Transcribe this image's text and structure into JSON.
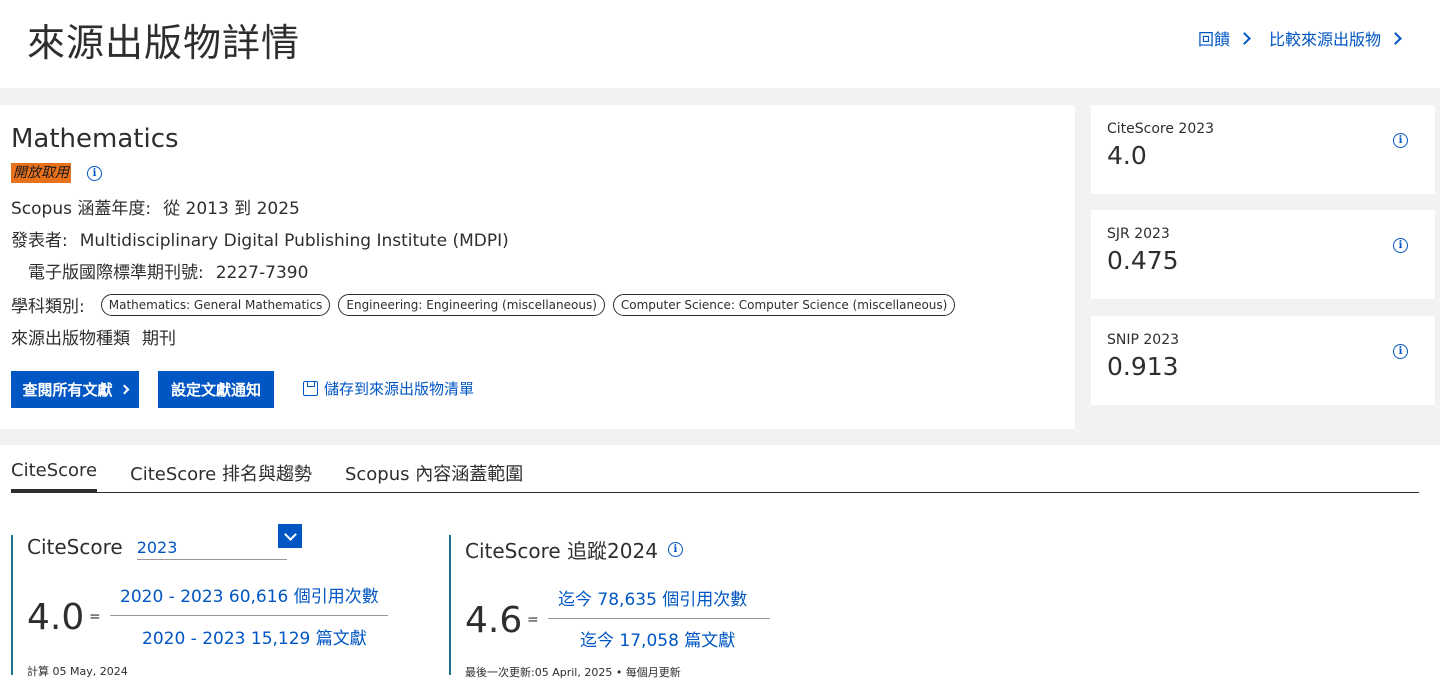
{
  "header": {
    "title": "來源出版物詳情",
    "feedback_label": "回饋",
    "compare_label": "比較來源出版物"
  },
  "journal": {
    "title": "Mathematics",
    "open_access": "開放取用",
    "coverage_label": "Scopus 涵蓋年度:",
    "coverage_value": "從 2013 到 2025",
    "publisher_label": "發表者:",
    "publisher_value": "Multidisciplinary Digital Publishing Institute (MDPI)",
    "eissn_label": "電子版國際標準期刊號:",
    "eissn_value": "2227-7390",
    "subject_label": "學科類別:",
    "subjects": [
      "Mathematics: General Mathematics",
      "Engineering: Engineering (miscellaneous)",
      "Computer Science: Computer Science (miscellaneous)"
    ],
    "type_label": "來源出版物種類",
    "type_value": "期刊",
    "view_docs_label": "查閱所有文獻",
    "set_alert_label": "設定文獻通知",
    "save_label": "儲存到來源出版物清單"
  },
  "metrics": [
    {
      "label": "CiteScore 2023",
      "value": "4.0"
    },
    {
      "label": "SJR 2023",
      "value": "0.475"
    },
    {
      "label": "SNIP 2023",
      "value": "0.913"
    }
  ],
  "tabs": [
    "CiteScore",
    "CiteScore 排名與趨勢",
    "Scopus 內容涵蓋範圍"
  ],
  "citescore": {
    "title": "CiteScore",
    "year": "2023",
    "value": "4.0",
    "eq": "=",
    "numerator": "2020 - 2023 60,616 個引用次數",
    "denominator": "2020 - 2023 15,129 篇文獻",
    "calc_note": "計算 05 May, 2024"
  },
  "tracker": {
    "title": "CiteScore 追蹤2024",
    "value": "4.6",
    "eq": "=",
    "numerator": "迄今 78,635 個引用次數",
    "denominator": "迄今 17,058 篇文獻",
    "update_note": "最後一次更新:05 April, 2025 • 每個月更新"
  }
}
